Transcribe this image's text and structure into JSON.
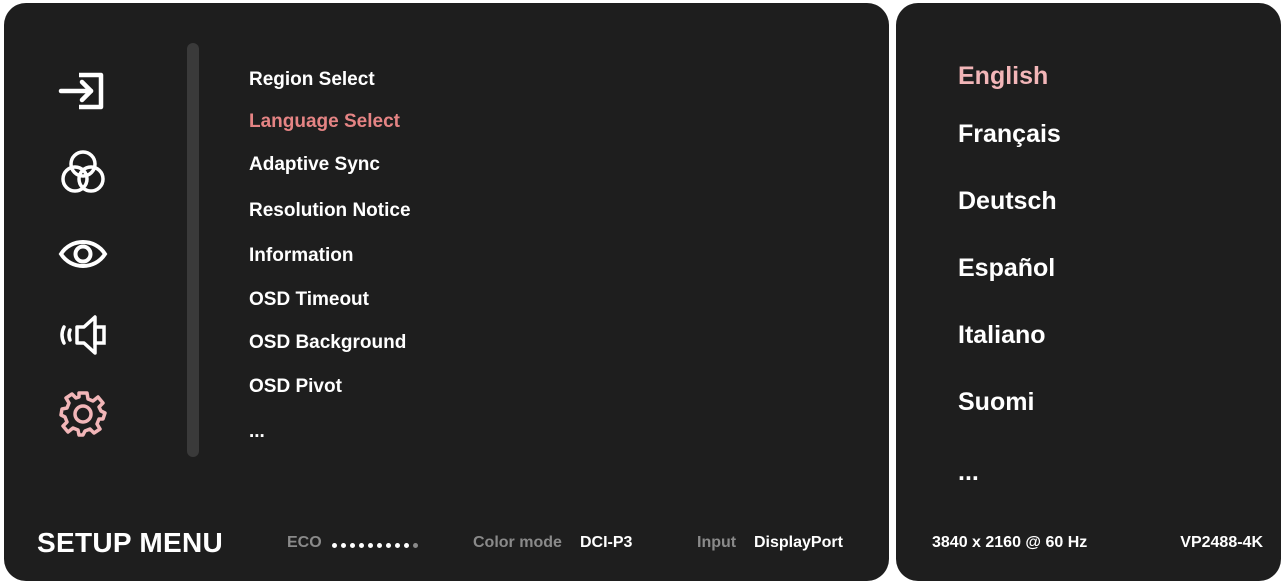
{
  "menu": {
    "title": "SETUP MENU",
    "items": [
      {
        "label": "Region Select",
        "active": false
      },
      {
        "label": "Language Select",
        "active": true
      },
      {
        "label": "Adaptive Sync",
        "active": false
      },
      {
        "label": "Resolution Notice",
        "active": false
      },
      {
        "label": "Information",
        "active": false
      },
      {
        "label": "OSD Timeout",
        "active": false
      },
      {
        "label": "OSD Background",
        "active": false
      },
      {
        "label": "OSD Pivot",
        "active": false
      },
      {
        "label": "...",
        "active": false
      }
    ],
    "categories": [
      {
        "icon": "input-icon"
      },
      {
        "icon": "color-adjust-icon"
      },
      {
        "icon": "eye-icon"
      },
      {
        "icon": "audio-icon"
      },
      {
        "icon": "gear-icon",
        "active": true
      }
    ]
  },
  "languages": {
    "items": [
      {
        "label": "English",
        "active": true
      },
      {
        "label": "Français",
        "active": false
      },
      {
        "label": "Deutsch",
        "active": false
      },
      {
        "label": "Español",
        "active": false
      },
      {
        "label": "Italiano",
        "active": false
      },
      {
        "label": "Suomi",
        "active": false
      },
      {
        "label": "...",
        "active": false
      }
    ]
  },
  "status": {
    "eco_label": "ECO",
    "eco_level": {
      "filled": 9,
      "total": 10
    },
    "color_mode_label": "Color mode",
    "color_mode_value": "DCI-P3",
    "input_label": "Input",
    "input_value": "DisplayPort",
    "resolution": "3840 x 2160 @ 60 Hz",
    "model": "VP2488-4K"
  },
  "colors": {
    "panel_bg": "#1e1e1e",
    "accent": "#e58484",
    "accent_light": "#f2b6b8",
    "muted": "#8a8a8a"
  }
}
